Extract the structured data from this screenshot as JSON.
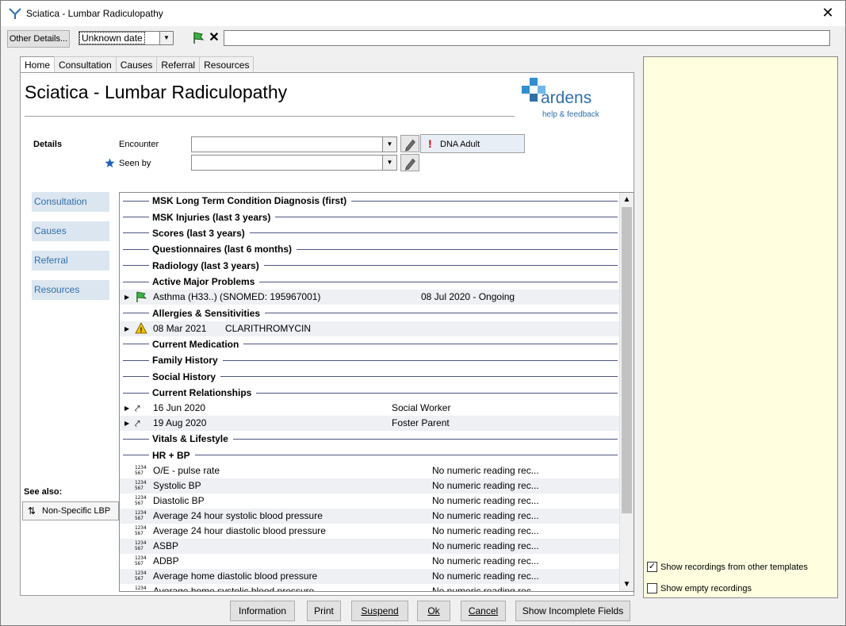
{
  "window": {
    "title": "Sciatica - Lumbar Radiculopathy"
  },
  "toolbar": {
    "other_details": "Other Details...",
    "date_value": "Unknown date"
  },
  "tabs": [
    "Home",
    "Consultation",
    "Causes",
    "Referral",
    "Resources"
  ],
  "page": {
    "title": "Sciatica - Lumbar Radiculopathy",
    "brand": "ardens",
    "brand_link": "help & feedback",
    "details_label": "Details",
    "encounter_label": "Encounter",
    "seen_by_label": "Seen by",
    "dna_button": "DNA Adult",
    "side_nav": [
      "Consultation",
      "Causes",
      "Referral",
      "Resources"
    ],
    "see_also": "See also:",
    "see_also_button": "Non-Specific LBP"
  },
  "list": {
    "sections": {
      "s1": "MSK Long Term Condition Diagnosis (first)",
      "s2": "MSK Injuries (last 3 years)",
      "s3": "Scores (last 3 years)",
      "s4": "Questionnaires (last 6 months)",
      "s5": "Radiology (last 3 years)",
      "s6": "Active Major Problems",
      "s7": "Allergies & Sensitivities",
      "s8": "Current Medication",
      "s9": "Family History",
      "s10": "Social History",
      "s11": "Current Relationships",
      "s12": "Vitals & Lifestyle",
      "s13": "HR + BP"
    },
    "problem": {
      "name": "Asthma (H33..) (SNOMED: 195967001)",
      "date": "08 Jul 2020 - Ongoing"
    },
    "allergy": {
      "date": "08 Mar 2021",
      "name": "CLARITHROMYCIN"
    },
    "relationships": [
      {
        "date": "16 Jun 2020",
        "role": "Social Worker"
      },
      {
        "date": "19 Aug 2020",
        "role": "Foster Parent"
      }
    ],
    "vitals": [
      {
        "name": "O/E - pulse rate",
        "value": "No numeric reading rec..."
      },
      {
        "name": "Systolic BP",
        "value": "No numeric reading rec..."
      },
      {
        "name": "Diastolic BP",
        "value": "No numeric reading rec..."
      },
      {
        "name": "Average 24 hour systolic blood pressure",
        "value": "No numeric reading rec..."
      },
      {
        "name": "Average 24 hour diastolic blood pressure",
        "value": "No numeric reading rec..."
      },
      {
        "name": "ASBP",
        "value": "No numeric reading rec..."
      },
      {
        "name": "ADBP",
        "value": "No numeric reading rec..."
      },
      {
        "name": "Average home diastolic blood pressure",
        "value": "No numeric reading rec..."
      },
      {
        "name": "Average home systolic blood pressure",
        "value": "No numeric reading rec..."
      }
    ],
    "numeric_icon": "1234 567"
  },
  "right_panel": {
    "show_other_templates": "Show recordings from other templates",
    "show_empty": "Show empty recordings"
  },
  "buttons": {
    "information": "Information",
    "print": "Print",
    "suspend": "Suspend",
    "ok": "Ok",
    "cancel": "Cancel",
    "show_incomplete": "Show Incomplete Fields"
  },
  "colors": {
    "accent": "#2f6fa8",
    "panel": "#ffffe0",
    "nav": "#dce6f0"
  }
}
